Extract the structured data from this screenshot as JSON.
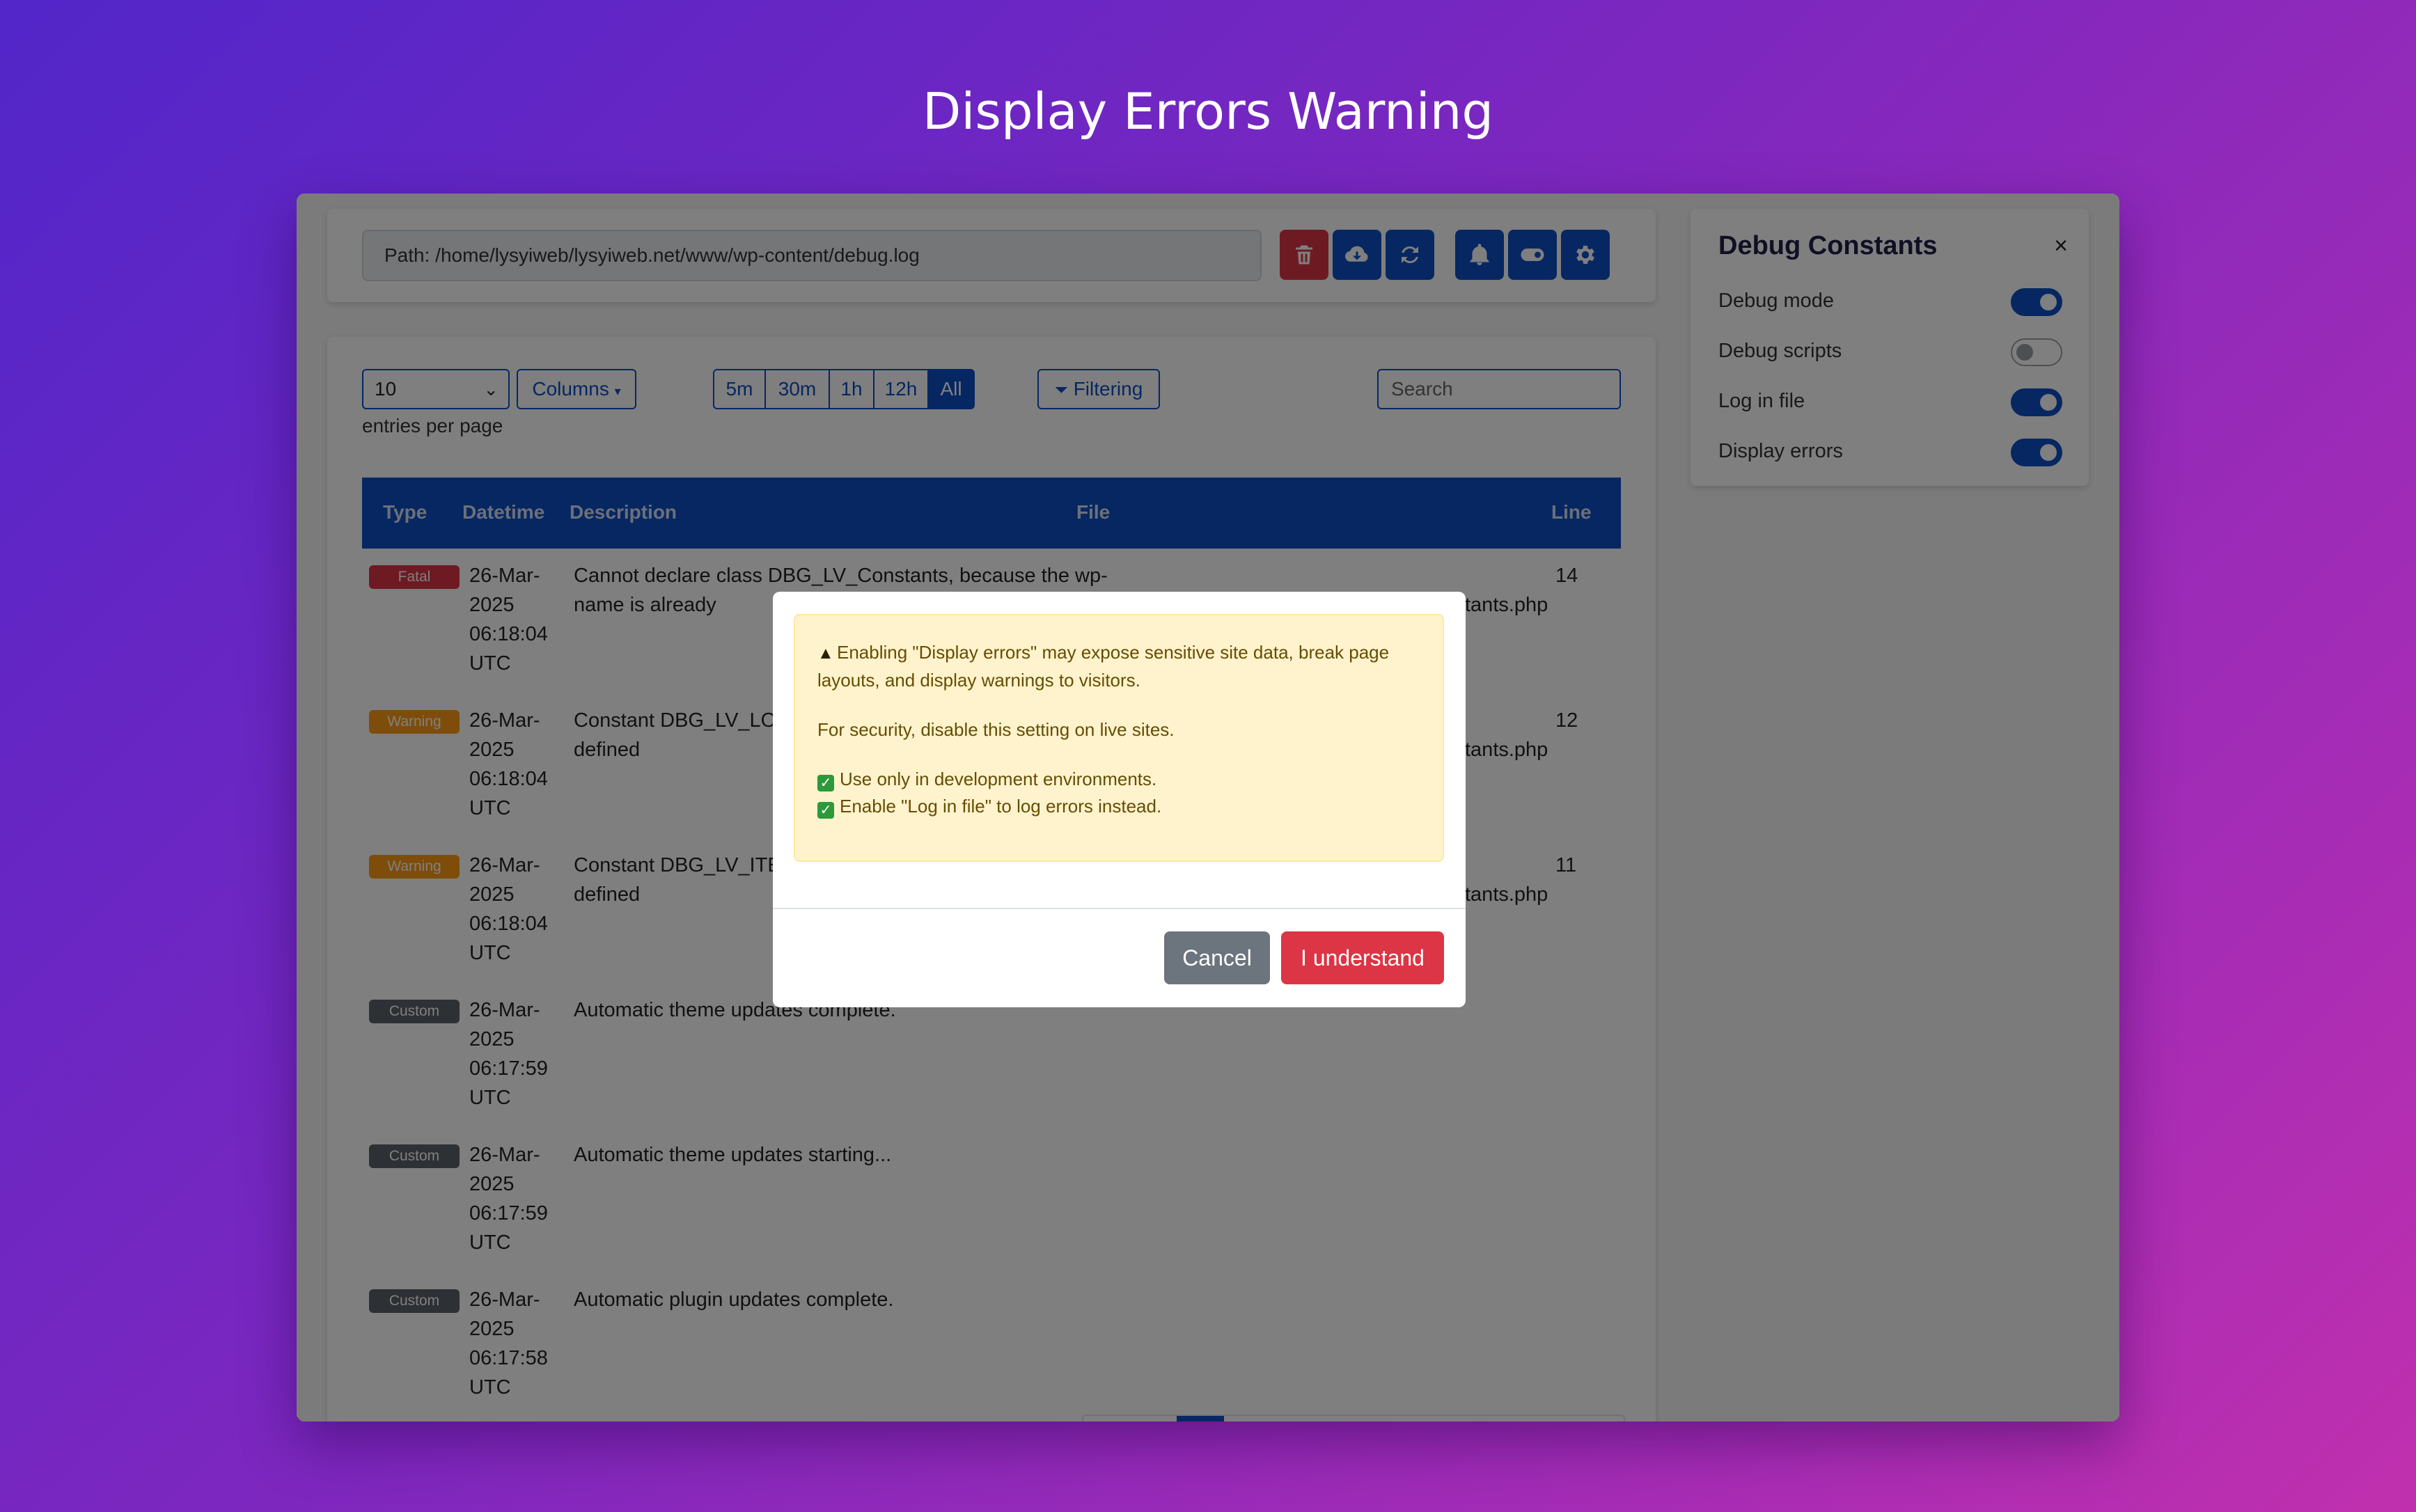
{
  "page": {
    "title": "Display Errors Warning"
  },
  "toolbar": {
    "path": "Path: /home/lysyiweb/lysyiweb.net/www/wp-content/debug.log",
    "buttons": [
      "trash-icon",
      "cloud-download-icon",
      "refresh-icon",
      "bell-icon",
      "toggle-icon",
      "gear-icon"
    ]
  },
  "controls": {
    "entries_value": "10",
    "entries_label": "entries per page",
    "columns_label": "Columns",
    "ranges": [
      "5m",
      "30m",
      "1h",
      "12h",
      "All"
    ],
    "active_range": "All",
    "filter_label": "Filtering",
    "search_placeholder": "Search"
  },
  "table": {
    "headers": {
      "type": "Type",
      "datetime": "Datetime",
      "description": "Description",
      "file": "File",
      "line": "Line"
    },
    "rows": [
      {
        "type": "Fatal",
        "datetime": "26-Mar-2025 06:18:04 UTC",
        "description": "Cannot declare class DBG_LV_Constants, because the name is already",
        "file": "wp-",
        "file_tail": "tants.php",
        "line": "14"
      },
      {
        "type": "Warning",
        "datetime": "26-Mar-2025 06:18:04 UTC",
        "description": "Constant DBG_LV_LO",
        "description_tail": "defined",
        "file": "",
        "file_tail": "tants.php",
        "line": "12"
      },
      {
        "type": "Warning",
        "datetime": "26-Mar-2025 06:18:04 UTC",
        "description": "Constant DBG_LV_ITE",
        "description_tail": "defined",
        "file": "",
        "file_tail": "tants.php",
        "line": "11"
      },
      {
        "type": "Custom",
        "datetime": "26-Mar-2025 06:17:59 UTC",
        "description": "Automatic theme updates complete.",
        "file": "",
        "line": ""
      },
      {
        "type": "Custom",
        "datetime": "26-Mar-2025 06:17:59 UTC",
        "description": "Automatic theme updates starting...",
        "file": "",
        "line": ""
      },
      {
        "type": "Custom",
        "datetime": "26-Mar-2025 06:17:58 UTC",
        "description": "Automatic plugin updates complete.",
        "file": "",
        "line": ""
      }
    ]
  },
  "panel": {
    "title": "Debug Constants",
    "close": "×",
    "items": [
      {
        "label": "Debug mode",
        "on": true
      },
      {
        "label": "Debug scripts",
        "on": false
      },
      {
        "label": "Log in file",
        "on": true
      },
      {
        "label": "Display errors",
        "on": true
      }
    ]
  },
  "modal": {
    "warning_text": "Enabling \"Display errors\" may expose sensitive site data, break page layouts, and display warnings to visitors.",
    "security_text": "For security, disable this setting on live sites.",
    "check1": "Use only in development environments.",
    "check2": "Enable \"Log in file\" to log errors instead.",
    "cancel_label": "Cancel",
    "confirm_label": "I understand"
  },
  "colors": {
    "primary": "#0d4ec4",
    "danger": "#dc3545",
    "warning_badge": "#fd9b14",
    "custom_badge": "#5a6068",
    "alert_bg": "#fff3cd"
  }
}
